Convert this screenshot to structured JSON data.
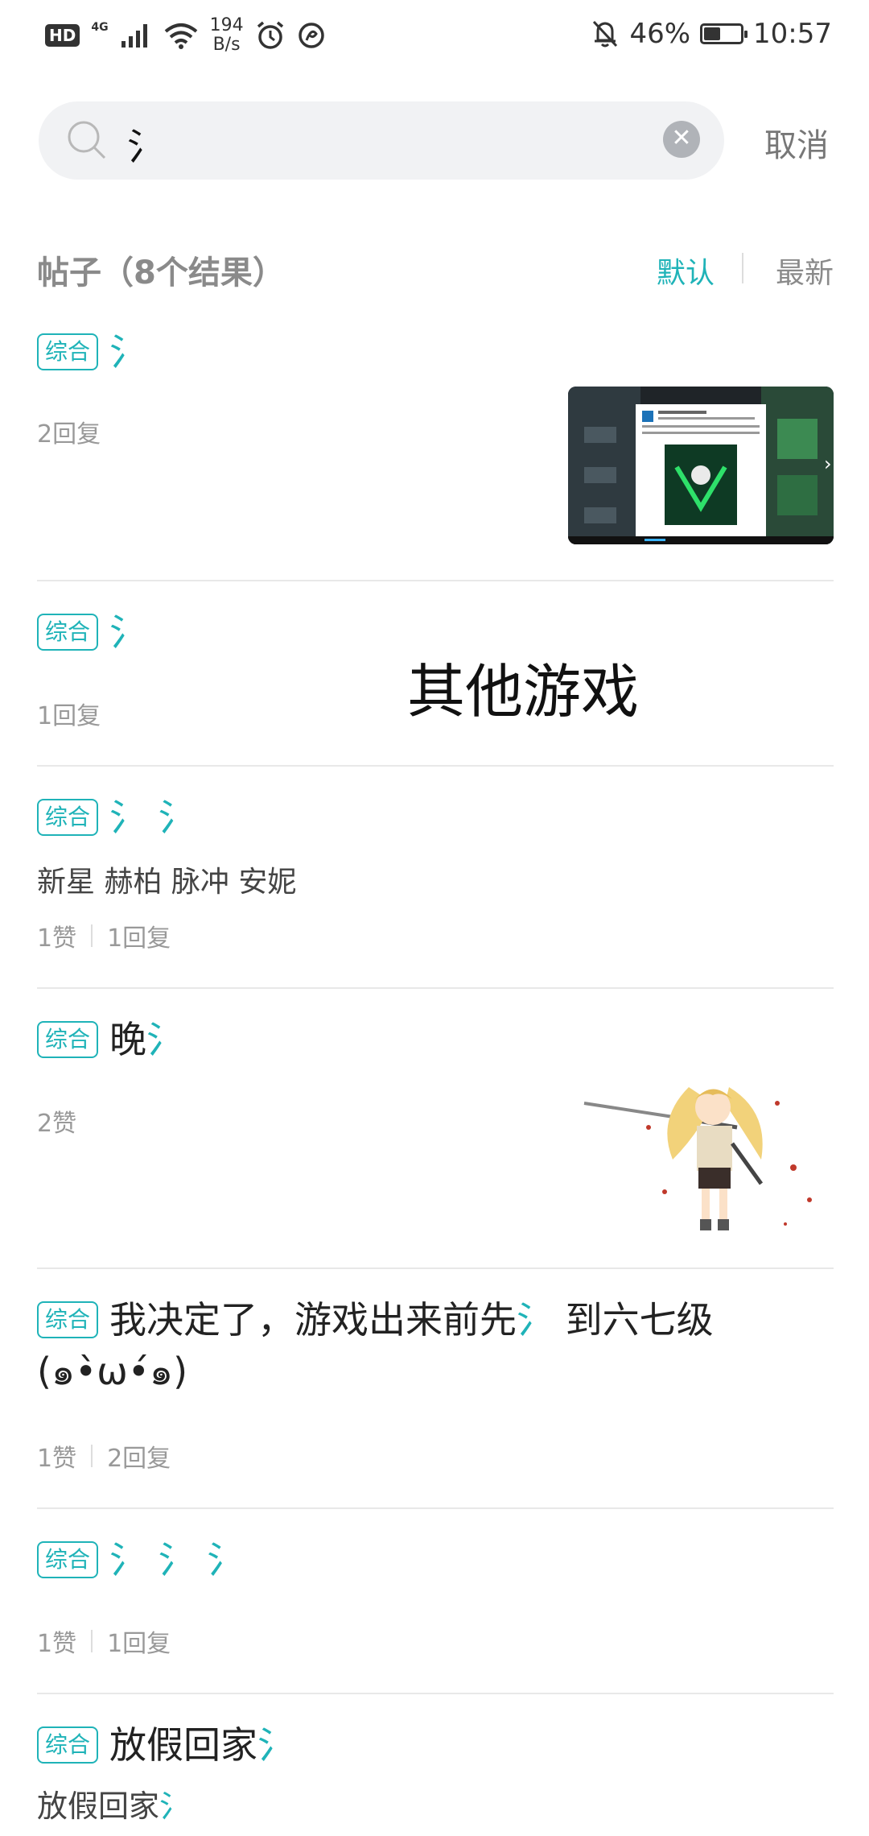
{
  "status_bar": {
    "hd": "HD",
    "network": "4G",
    "speed_value": "194",
    "speed_unit": "B/s",
    "battery": "46%",
    "battery_level": 0.46,
    "time": "10:57"
  },
  "search": {
    "query": "氵",
    "cancel_label": "取消"
  },
  "results_header": {
    "title": "帖子（8个结果）",
    "sort_default": "默认",
    "sort_latest": "最新"
  },
  "overlay_text": "其他游戏",
  "posts": [
    {
      "tag": "综合",
      "title_plain": "",
      "title_hl": "氵",
      "meta": [
        "2回复"
      ]
    },
    {
      "tag": "综合",
      "title_plain": "",
      "title_hl": "氵",
      "meta": [
        "1回复"
      ]
    },
    {
      "tag": "综合",
      "title_plain": "",
      "title_hl": "氵 氵",
      "body": "新星 赫柏 脉冲 安妮",
      "meta": [
        "1赞",
        "1回复"
      ]
    },
    {
      "tag": "综合",
      "title_plain": "晚",
      "title_hl": "氵",
      "meta": [
        "2赞"
      ]
    },
    {
      "tag": "综合",
      "title_plain": "我决定了，游戏出来前先",
      "title_hl": "氵",
      "title_after": " 到六七级",
      "title_line2": "(๑•̀ω•́๑)",
      "meta": [
        "1赞",
        "2回复"
      ]
    },
    {
      "tag": "综合",
      "title_plain": "",
      "title_hl": "氵 氵 氵",
      "meta": [
        "1赞",
        "1回复"
      ]
    },
    {
      "tag": "综合",
      "title_plain": "放假回家",
      "title_hl": "氵",
      "body_plain": "放假回家",
      "body_hl": "氵"
    }
  ],
  "colors": {
    "accent": "#1fb3b8",
    "meta_text": "#999999",
    "search_bg": "#f1f2f4"
  }
}
